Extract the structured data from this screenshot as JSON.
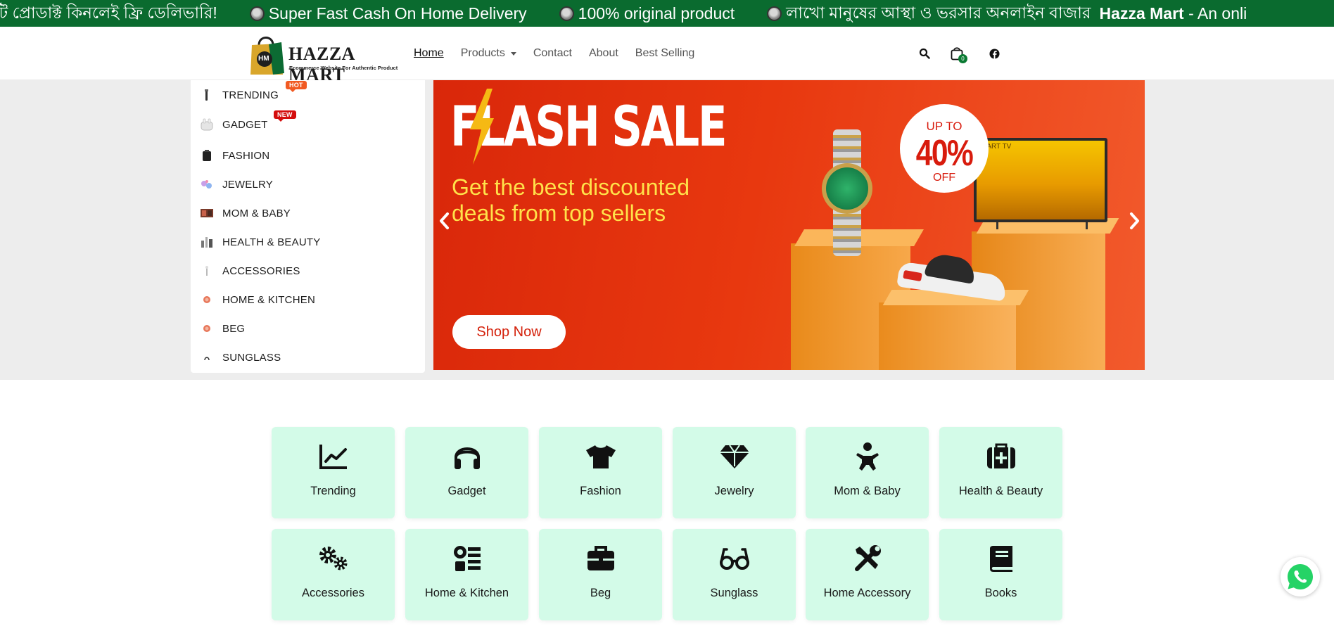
{
  "marquee": {
    "items": [
      {
        "text": "টি প্রোডাক্ট কিনলেই ফ্রি ডেলিভারি!",
        "bullet": false
      },
      {
        "text": "Super Fast Cash On Home Delivery",
        "bullet": true
      },
      {
        "text": "100% original product",
        "bullet": true
      },
      {
        "text": "লাখো মানুষের আস্থা ও ভরসার অনলাইন বাজার",
        "bullet": true
      }
    ],
    "brand": "Hazza Mart",
    "brand_suffix": " - An onli",
    "bg_color": "#0a6b2f"
  },
  "header": {
    "logo": {
      "initials": "HM",
      "name": "HAZZA MART",
      "tagline": "Ecommerce Website For Authentic Product"
    },
    "nav": [
      {
        "label": "Home",
        "active": true
      },
      {
        "label": "Products",
        "dropdown": true
      },
      {
        "label": "Contact"
      },
      {
        "label": "About"
      },
      {
        "label": "Best Selling"
      }
    ],
    "icons": [
      "search-icon",
      "cart-icon",
      "facebook-icon"
    ],
    "cart_count": "0"
  },
  "sidebar": {
    "items": [
      {
        "label": "TRENDING",
        "badge": "HOT"
      },
      {
        "label": "GADGET",
        "badge": "NEW"
      },
      {
        "label": "FASHION"
      },
      {
        "label": "JEWELRY"
      },
      {
        "label": "MOM & BABY"
      },
      {
        "label": "HEALTH & BEAUTY"
      },
      {
        "label": "ACCESSORIES"
      },
      {
        "label": "HOME & KITCHEN"
      },
      {
        "label": "BEG"
      },
      {
        "label": "SUNGLASS"
      }
    ]
  },
  "banner": {
    "title": "FLASH SALE",
    "subtitle": "Get the best discounted deals from top sellers",
    "badge_top": "UP TO",
    "badge_value": "40%",
    "badge_bottom": "OFF",
    "tv_label": "MART TV",
    "button": "Shop Now"
  },
  "categories": [
    {
      "label": "Trending",
      "icon": "chart-line-icon"
    },
    {
      "label": "Gadget",
      "icon": "headphones-icon"
    },
    {
      "label": "Fashion",
      "icon": "tshirt-icon"
    },
    {
      "label": "Jewelry",
      "icon": "gem-icon"
    },
    {
      "label": "Mom & Baby",
      "icon": "baby-icon"
    },
    {
      "label": "Health & Beauty",
      "icon": "medkit-icon"
    },
    {
      "label": "Accessories",
      "icon": "gears-icon"
    },
    {
      "label": "Home & Kitchen",
      "icon": "kitchen-icon"
    },
    {
      "label": "Beg",
      "icon": "briefcase-icon"
    },
    {
      "label": "Sunglass",
      "icon": "glasses-icon"
    },
    {
      "label": "Home Accessory",
      "icon": "tools-icon"
    },
    {
      "label": "Books",
      "icon": "book-icon"
    }
  ],
  "colors": {
    "accent_green": "#0a6b2f",
    "category_bg": "#d3fbe8",
    "banner_red": "#e8380f",
    "banner_yellow": "#ffe24a"
  }
}
